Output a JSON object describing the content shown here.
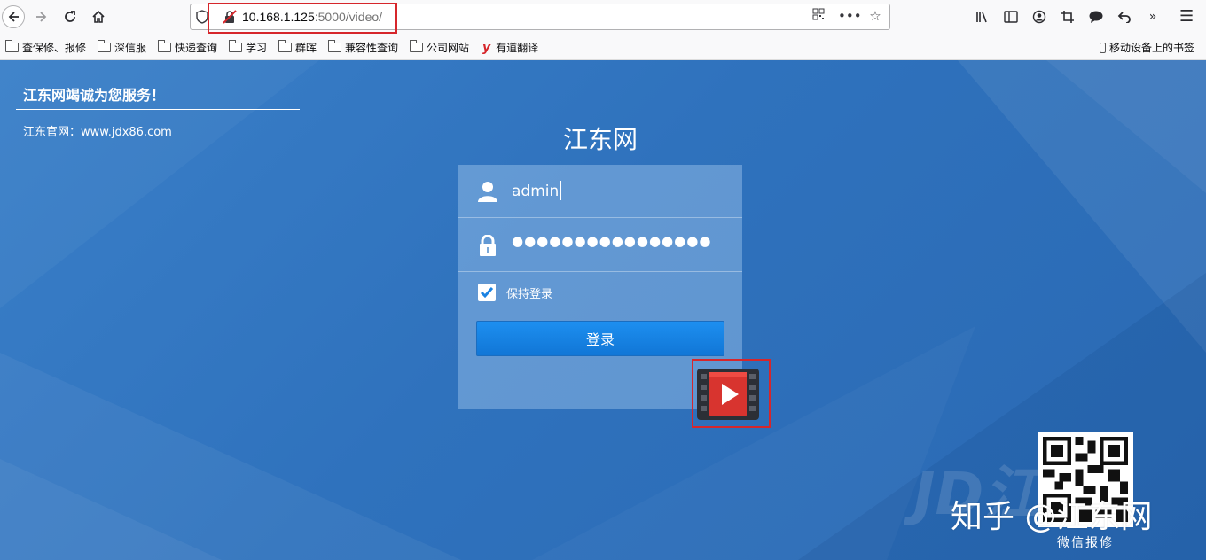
{
  "browser": {
    "url_host": "10.168.1.125",
    "url_path": ":5000/video/",
    "nav": {
      "back": "back-icon",
      "forward": "forward-icon",
      "reload": "reload-icon",
      "home": "home-icon"
    },
    "toolbar_icons": [
      "library-icon",
      "sidebar-icon",
      "account-icon",
      "screenshot-icon",
      "chat-icon",
      "undo-icon",
      "overflow-icon"
    ],
    "bookmarks": [
      {
        "label": "查保修、报修",
        "icon": "folder-icon"
      },
      {
        "label": "深信服",
        "icon": "folder-icon"
      },
      {
        "label": "快递查询",
        "icon": "folder-icon"
      },
      {
        "label": "学习",
        "icon": "folder-icon"
      },
      {
        "label": "群晖",
        "icon": "folder-icon"
      },
      {
        "label": "兼容性查询",
        "icon": "folder-icon"
      },
      {
        "label": "公司网站",
        "icon": "folder-icon"
      },
      {
        "label": "有道翻译",
        "icon": "youdao-icon"
      }
    ],
    "mobile_bookmarks": "移动设备上的书签"
  },
  "page": {
    "slogan": "江东网竭诚为您服务！",
    "site": "江东官网：www.jdx86.com",
    "title": "江东网",
    "login": {
      "username": "admin",
      "password_mask": "●●●●●●●●●●●●●●●●",
      "remember_label": "保持登录",
      "remember_checked": true,
      "submit_label": "登录"
    },
    "qr_caption": "微信报修",
    "watermark_zhihu": "知乎 @江东网",
    "colors": {
      "background": "#2f72bd",
      "button": "#1a82e2",
      "highlight": "#d6262b"
    }
  }
}
